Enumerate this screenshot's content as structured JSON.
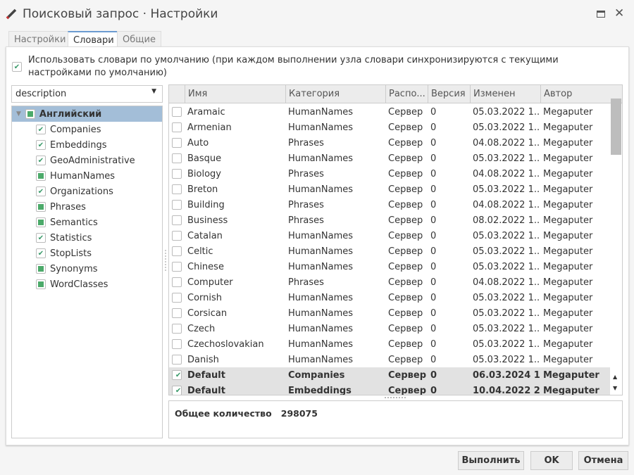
{
  "window": {
    "title": "Поисковый запрос · Настройки",
    "icon": "pencil-icon"
  },
  "tabs": [
    {
      "label": "Настройки"
    },
    {
      "label": "Словари"
    },
    {
      "label": "Общие"
    }
  ],
  "use_default": {
    "checked": true,
    "label": "Использовать словари по умолчанию (при каждом выполнении узла словари синхронизируются с текущими настройками по умолчанию)"
  },
  "dropdown": {
    "value": "description"
  },
  "tree": {
    "root": "Английский",
    "children": [
      {
        "label": "Companies",
        "state": "checked"
      },
      {
        "label": "Embeddings",
        "state": "checked"
      },
      {
        "label": "GeoAdministrative",
        "state": "checked"
      },
      {
        "label": "HumanNames",
        "state": "partial"
      },
      {
        "label": "Organizations",
        "state": "checked"
      },
      {
        "label": "Phrases",
        "state": "partial"
      },
      {
        "label": "Semantics",
        "state": "partial"
      },
      {
        "label": "Statistics",
        "state": "checked"
      },
      {
        "label": "StopLists",
        "state": "checked"
      },
      {
        "label": "Synonyms",
        "state": "partial"
      },
      {
        "label": "WordClasses",
        "state": "partial"
      }
    ]
  },
  "grid": {
    "columns": [
      "Имя",
      "Категория",
      "Распо...",
      "Версия",
      "Изменен",
      "Автор"
    ],
    "rows": [
      [
        "Aramaic",
        "HumanNames",
        "Сервер",
        "0",
        "05.03.2022 1...",
        "Megaputer",
        false
      ],
      [
        "Armenian",
        "HumanNames",
        "Сервер",
        "0",
        "05.03.2022 1...",
        "Megaputer",
        false
      ],
      [
        "Auto",
        "Phrases",
        "Сервер",
        "0",
        "04.08.2022 1...",
        "Megaputer",
        false
      ],
      [
        "Basque",
        "HumanNames",
        "Сервер",
        "0",
        "05.03.2022 1...",
        "Megaputer",
        false
      ],
      [
        "Biology",
        "Phrases",
        "Сервер",
        "0",
        "04.08.2022 1...",
        "Megaputer",
        false
      ],
      [
        "Breton",
        "HumanNames",
        "Сервер",
        "0",
        "05.03.2022 1...",
        "Megaputer",
        false
      ],
      [
        "Building",
        "Phrases",
        "Сервер",
        "0",
        "04.08.2022 1...",
        "Megaputer",
        false
      ],
      [
        "Business",
        "Phrases",
        "Сервер",
        "0",
        "08.02.2022 1...",
        "Megaputer",
        false
      ],
      [
        "Catalan",
        "HumanNames",
        "Сервер",
        "0",
        "05.03.2022 1...",
        "Megaputer",
        false
      ],
      [
        "Celtic",
        "HumanNames",
        "Сервер",
        "0",
        "05.03.2022 1...",
        "Megaputer",
        false
      ],
      [
        "Chinese",
        "HumanNames",
        "Сервер",
        "0",
        "05.03.2022 1...",
        "Megaputer",
        false
      ],
      [
        "Computer",
        "Phrases",
        "Сервер",
        "0",
        "04.08.2022 1...",
        "Megaputer",
        false
      ],
      [
        "Cornish",
        "HumanNames",
        "Сервер",
        "0",
        "05.03.2022 1...",
        "Megaputer",
        false
      ],
      [
        "Corsican",
        "HumanNames",
        "Сервер",
        "0",
        "05.03.2022 1...",
        "Megaputer",
        false
      ],
      [
        "Czech",
        "HumanNames",
        "Сервер",
        "0",
        "05.03.2022 1...",
        "Megaputer",
        false
      ],
      [
        "Czechoslovakian",
        "HumanNames",
        "Сервер",
        "0",
        "05.03.2022 1...",
        "Megaputer",
        false
      ],
      [
        "Danish",
        "HumanNames",
        "Сервер",
        "0",
        "05.03.2022 1...",
        "Megaputer",
        false
      ],
      [
        "Default",
        "Companies",
        "Сервер",
        "0",
        "06.03.2024 1...",
        "Megaputer",
        true
      ],
      [
        "Default",
        "Embeddings",
        "Сервер",
        "0",
        "10.04.2022 2...",
        "Megaputer",
        true
      ]
    ]
  },
  "summary": {
    "label": "Общее количество",
    "value": "298075"
  },
  "buttons": {
    "run": "Выполнить",
    "ok": "OK",
    "cancel": "Отмена"
  }
}
